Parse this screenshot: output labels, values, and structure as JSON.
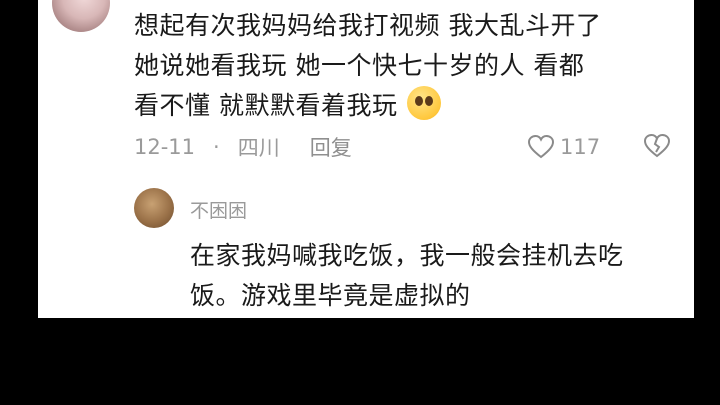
{
  "comment": {
    "text_line1": "想起有次我妈妈给我打视频  我大乱斗开了",
    "text_line2": "她说她看我玩  她一个快七十岁的人  看都",
    "text_line3": "看不懂  就默默看着我玩",
    "emoji": "pleading-face-emoji",
    "date": "12-11",
    "separator": "·",
    "location": "四川",
    "reply_label": "回复",
    "like_count": "117"
  },
  "reply": {
    "username": "不困困",
    "text_line1": "在家我妈喊我吃饭，我一般会挂机去吃",
    "text_line2": "饭。游戏里毕竟是虚拟的"
  }
}
